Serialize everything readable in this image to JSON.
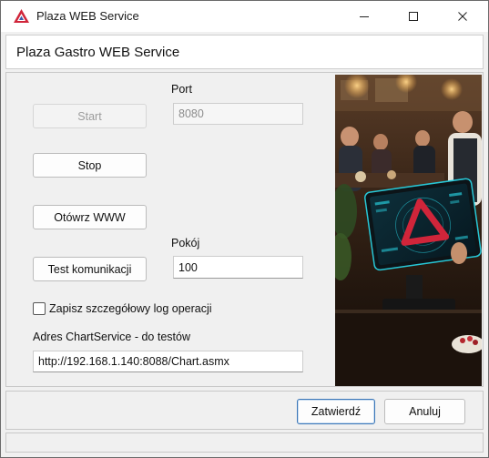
{
  "window": {
    "title": "Plaza WEB Service",
    "controls": {
      "minimize": "minimize",
      "maximize": "maximize",
      "close": "close"
    }
  },
  "header": {
    "title": "Plaza Gastro WEB Service"
  },
  "form": {
    "start_label": "Start",
    "stop_label": "Stop",
    "open_www_label": "Otówrz WWW",
    "test_comm_label": "Test komunikacji",
    "port_label": "Port",
    "port_value": "8080",
    "room_label": "Pokój",
    "room_value": "100",
    "detailed_log_label": "Zapisz szczegółowy log operacji",
    "detailed_log_checked": false,
    "chart_service_label": "Adres ChartService - do testów",
    "chart_service_value": "http://192.168.1.140:8088/Chart.asmx"
  },
  "footer": {
    "confirm_label": "Zatwierdź",
    "cancel_label": "Anuluj"
  },
  "colors": {
    "accent": "#3b77b8",
    "logo_red": "#d0253a",
    "screen_cyan": "#27c7d6"
  },
  "icons": {
    "app": "plaza-logo-icon",
    "minimize": "minimize-icon",
    "maximize": "maximize-icon",
    "close": "close-icon"
  }
}
